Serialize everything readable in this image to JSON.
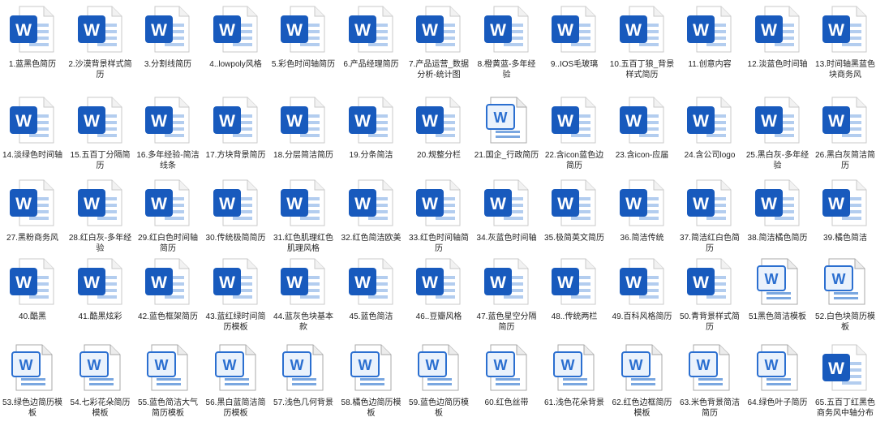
{
  "icon_letter": "W",
  "colors": {
    "word_blue": "#185abd",
    "word_light": "#41a5ee",
    "page": "#ffffff",
    "text": "#1f1f1f"
  },
  "files": [
    {
      "name": "1.蓝黑色简历",
      "style": "modern"
    },
    {
      "name": "2.沙漠背景样式简历",
      "style": "modern"
    },
    {
      "name": "3.分割线简历",
      "style": "modern"
    },
    {
      "name": "4..lowpoly风格",
      "style": "modern"
    },
    {
      "name": "5.彩色时间轴简历",
      "style": "modern"
    },
    {
      "name": "6.产品经理简历",
      "style": "modern"
    },
    {
      "name": "7.产品运营_数据分析-统计图",
      "style": "modern"
    },
    {
      "name": "8.橙黄蓝-多年经验",
      "style": "modern"
    },
    {
      "name": "9..IOS毛玻璃",
      "style": "modern"
    },
    {
      "name": "10.五百丁狼_背景样式简历",
      "style": "modern"
    },
    {
      "name": "11.创意内容",
      "style": "modern"
    },
    {
      "name": "12.淡蓝色时间轴",
      "style": "modern"
    },
    {
      "name": "13.时间轴黑蓝色块商务风",
      "style": "modern"
    },
    {
      "name": "14.淡绿色时间轴",
      "style": "modern"
    },
    {
      "name": "15.五百丁分隔简历",
      "style": "modern"
    },
    {
      "name": "16.多年经验-简洁线条",
      "style": "modern"
    },
    {
      "name": "17.方块背景简历",
      "style": "modern"
    },
    {
      "name": "18.分层简洁简历",
      "style": "modern"
    },
    {
      "name": "19.分条简洁",
      "style": "modern"
    },
    {
      "name": "20.规整分栏",
      "style": "modern"
    },
    {
      "name": "21.国企_行政简历",
      "style": "legacy"
    },
    {
      "name": "22.含icon蓝色边简历",
      "style": "modern"
    },
    {
      "name": "23.含icon-应届",
      "style": "modern"
    },
    {
      "name": "24.含公司logo",
      "style": "modern"
    },
    {
      "name": "25.黑白灰-多年经验",
      "style": "modern"
    },
    {
      "name": "26.黑白灰简洁简历",
      "style": "modern"
    },
    {
      "name": "27.黑粉商务风",
      "style": "modern"
    },
    {
      "name": "28.红白灰-多年经验",
      "style": "modern"
    },
    {
      "name": "29.红白色时间轴简历",
      "style": "modern"
    },
    {
      "name": "30.传统极简简历",
      "style": "modern"
    },
    {
      "name": "31.红色肌理红色肌理风格",
      "style": "modern"
    },
    {
      "name": "32.红色简洁欧美",
      "style": "modern"
    },
    {
      "name": "33.红色时间轴简历",
      "style": "modern"
    },
    {
      "name": "34.灰蓝色时间轴",
      "style": "modern"
    },
    {
      "name": "35.极简英文简历",
      "style": "modern"
    },
    {
      "name": "36.简洁传统",
      "style": "modern"
    },
    {
      "name": "37.简洁红白色简历",
      "style": "modern"
    },
    {
      "name": "38.简洁橘色简历",
      "style": "modern"
    },
    {
      "name": "39.橘色简洁",
      "style": "modern"
    },
    {
      "name": "40.酷黑",
      "style": "modern"
    },
    {
      "name": "41.酷黑炫彩",
      "style": "modern"
    },
    {
      "name": "42.蓝色框架简历",
      "style": "modern"
    },
    {
      "name": "43.蓝红绿时间简历模板",
      "style": "modern"
    },
    {
      "name": "44.蓝灰色块基本款",
      "style": "modern"
    },
    {
      "name": "45.蓝色简洁",
      "style": "modern"
    },
    {
      "name": "46..豆瓣风格",
      "style": "modern"
    },
    {
      "name": "47.蓝色星空分隔简历",
      "style": "modern"
    },
    {
      "name": "48..传统两栏",
      "style": "modern"
    },
    {
      "name": "49.百科风格简历",
      "style": "modern"
    },
    {
      "name": "50.青背景样式简历",
      "style": "modern"
    },
    {
      "name": "51黑色简洁模板",
      "style": "legacy"
    },
    {
      "name": "52.白色块简历模板",
      "style": "legacy"
    },
    {
      "name": "53.绿色边简历模板",
      "style": "legacy"
    },
    {
      "name": "54.七彩花朵简历模板",
      "style": "legacy"
    },
    {
      "name": "55.蓝色简洁大气简历模板",
      "style": "legacy"
    },
    {
      "name": "56.黑白蓝简洁简历模板",
      "style": "legacy"
    },
    {
      "name": "57.浅色几何背景",
      "style": "legacy"
    },
    {
      "name": "58.橘色边简历模板",
      "style": "legacy"
    },
    {
      "name": "59.蓝色边简历模板",
      "style": "legacy"
    },
    {
      "name": "60.红色丝带",
      "style": "legacy"
    },
    {
      "name": "61.浅色花朵背景",
      "style": "legacy"
    },
    {
      "name": "62.红色边框简历模板",
      "style": "legacy"
    },
    {
      "name": "63.米色背景简洁简历",
      "style": "legacy"
    },
    {
      "name": "64.绿色叶子简历",
      "style": "legacy"
    },
    {
      "name": "65.五百丁红黑色商务风中轴分布",
      "style": "modern"
    }
  ]
}
